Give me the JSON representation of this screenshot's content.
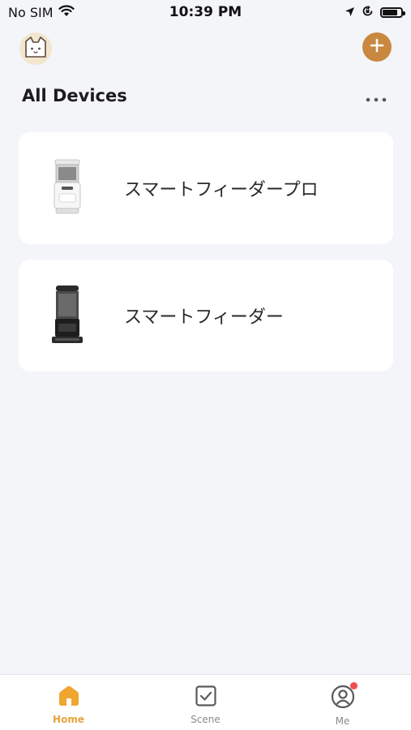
{
  "status_bar": {
    "carrier": "No SIM",
    "time": "10:39 PM",
    "icons": [
      "wifi-icon",
      "location-icon",
      "orientation-lock-icon",
      "battery-icon"
    ]
  },
  "header": {
    "avatar_icon": "cat-face-icon",
    "add_icon": "plus-icon",
    "title": "All Devices",
    "more_icon": "ellipsis-icon"
  },
  "devices": [
    {
      "name": "スマートフィーダープロ",
      "icon": "white-feeder-icon"
    },
    {
      "name": "スマートフィーダー",
      "icon": "black-feeder-icon"
    }
  ],
  "tab_bar": {
    "tabs": [
      {
        "label": "Home",
        "icon": "home-icon",
        "active": true
      },
      {
        "label": "Scene",
        "icon": "checkbox-icon",
        "active": false
      },
      {
        "label": "Me",
        "icon": "user-icon",
        "active": false,
        "badge": true
      }
    ]
  },
  "colors": {
    "accent": "#c9873f",
    "active_tab": "#e8a33a",
    "background": "#f4f5f9",
    "badge": "#f04c4c"
  }
}
